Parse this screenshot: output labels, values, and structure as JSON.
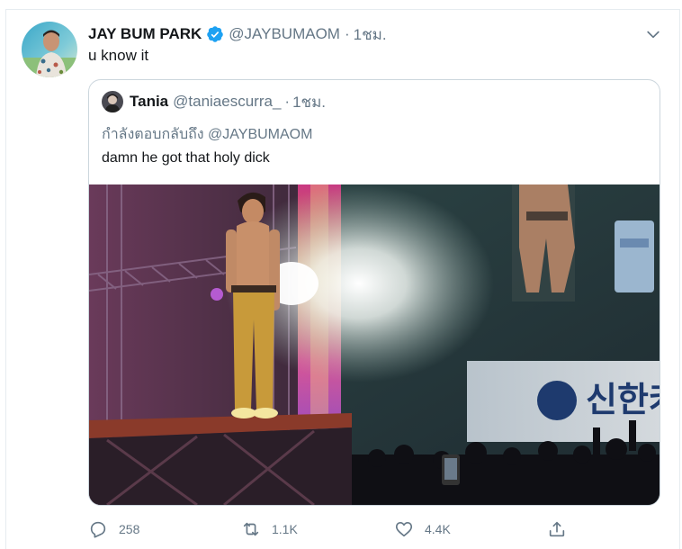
{
  "tweet": {
    "author": {
      "name": "JAY BUM PARK",
      "handle": "@JAYBUMAOM",
      "separator": "·",
      "time": "1ชม."
    },
    "text": "u know it",
    "quoted": {
      "author": {
        "name": "Tania",
        "handle": "@taniaescurra_",
        "separator": "·",
        "time": "1ชม."
      },
      "reply_prefix": "กำลังตอบกลับถึง",
      "reply_target": "@JAYBUMAOM",
      "text": "damn he got that holy dick",
      "media": {
        "screen_text": "신한카"
      }
    },
    "actions": {
      "reply_count": "258",
      "retweet_count": "1.1K",
      "like_count": "4.4K"
    }
  },
  "colors": {
    "text_primary": "#14171a",
    "text_secondary": "#657786",
    "verified_blue": "#1da1f2",
    "border": "#ccd6dd"
  },
  "icons": [
    "verified-badge-icon",
    "chevron-down-icon",
    "reply-icon",
    "retweet-icon",
    "like-icon",
    "share-icon"
  ]
}
